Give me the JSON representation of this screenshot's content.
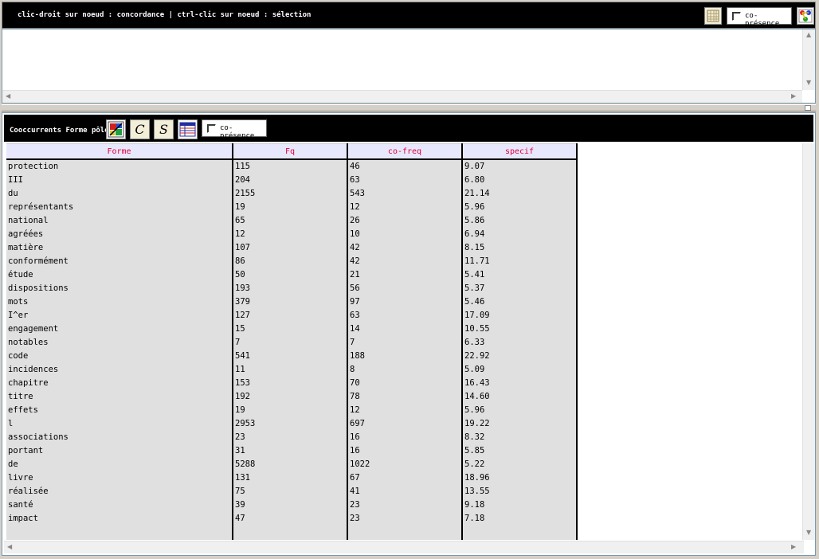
{
  "top_bar": {
    "hint": "clic-droit sur noeud : concordance | ctrl-clic sur noeud : sélection",
    "co_presence_label": "co-présence",
    "co_presence_checked": false,
    "icons": [
      "grid-icon",
      "network-graph-icon"
    ]
  },
  "cooc_bar": {
    "title": "Cooccurrents Forme pôle",
    "co_presence_label": "co-présence",
    "co_presence_checked": false,
    "icons": [
      "chart-icon",
      "c-letter-icon",
      "s-letter-icon",
      "table-icon"
    ]
  },
  "table": {
    "columns": [
      "Forme",
      "Fq",
      "co-freq",
      "specif"
    ],
    "rows": [
      [
        "protection",
        "115",
        "46",
        "9.07"
      ],
      [
        "III",
        "204",
        "63",
        "6.80"
      ],
      [
        "du",
        "2155",
        "543",
        "21.14"
      ],
      [
        "représentants",
        "19",
        "12",
        "5.96"
      ],
      [
        "national",
        "65",
        "26",
        "5.86"
      ],
      [
        "agréées",
        "12",
        "10",
        "6.94"
      ],
      [
        "matière",
        "107",
        "42",
        "8.15"
      ],
      [
        "conformément",
        "86",
        "42",
        "11.71"
      ],
      [
        "étude",
        "50",
        "21",
        "5.41"
      ],
      [
        "dispositions",
        "193",
        "56",
        "5.37"
      ],
      [
        "mots",
        "379",
        "97",
        "5.46"
      ],
      [
        "I^er",
        "127",
        "63",
        "17.09"
      ],
      [
        "engagement",
        "15",
        "14",
        "10.55"
      ],
      [
        "notables",
        "7",
        "7",
        "6.33"
      ],
      [
        "code",
        "541",
        "188",
        "22.92"
      ],
      [
        "incidences",
        "11",
        "8",
        "5.09"
      ],
      [
        "chapitre",
        "153",
        "70",
        "16.43"
      ],
      [
        "titre",
        "192",
        "78",
        "14.60"
      ],
      [
        "effets",
        "19",
        "12",
        "5.96"
      ],
      [
        "l",
        "2953",
        "697",
        "19.22"
      ],
      [
        "associations",
        "23",
        "16",
        "8.32"
      ],
      [
        "portant",
        "31",
        "16",
        "5.85"
      ],
      [
        "de",
        "5288",
        "1022",
        "5.22"
      ],
      [
        "livre",
        "131",
        "67",
        "18.96"
      ],
      [
        "réalisée",
        "75",
        "41",
        "13.55"
      ],
      [
        "santé",
        "39",
        "23",
        "9.18"
      ],
      [
        "impact",
        "47",
        "23",
        "7.18"
      ]
    ]
  },
  "colors": {
    "header_text": "#e0003c",
    "header_bg": "#e8e8fc",
    "column_bg": "#e0e0e0",
    "bar_bg": "#000000"
  }
}
